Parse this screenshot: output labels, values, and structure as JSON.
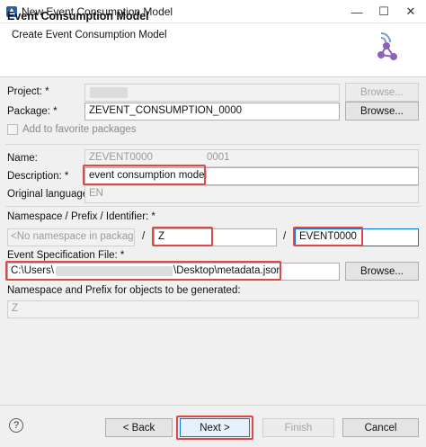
{
  "window": {
    "title": "New Event Consumption Model",
    "minimize_glyph": "—",
    "maximize_glyph": "☐",
    "close_glyph": "✕"
  },
  "banner": {
    "title": "Event Consumption Model",
    "subtitle": "Create Event Consumption Model"
  },
  "form": {
    "project_label": "Project: *",
    "project_value": "",
    "project_browse": "Browse...",
    "package_label": "Package: *",
    "package_value": "ZEVENT_CONSUMPTION_0000",
    "package_browse": "Browse...",
    "favorite_label": "Add to favorite packages",
    "name_label": "Name:",
    "name_value_left": "ZEVENT0000",
    "name_value_right": "0001",
    "description_label": "Description: *",
    "description_value": "event consumption model",
    "language_label": "Original language:",
    "language_value": "EN",
    "ns_label": "Namespace / Prefix / Identifier: *",
    "ns_select": "<No namespace in package>",
    "ns_sep1": "/",
    "prefix_value": "Z",
    "ns_sep2": "/",
    "identifier_value": "EVENT0000",
    "spec_label": "Event Specification File: *",
    "spec_value_start": "C:\\Users\\",
    "spec_value_end": "\\Desktop\\metadata.json",
    "spec_browse": "Browse...",
    "gen_label": "Namespace and Prefix for objects to be generated:",
    "gen_value": "Z"
  },
  "footer": {
    "help_glyph": "?",
    "back_label": "< Back",
    "next_label": "Next >",
    "finish_label": "Finish",
    "cancel_label": "Cancel"
  },
  "colors": {
    "highlight": "#d94b4b",
    "accent": "#0078d7",
    "banner_icon": "#8c63b8"
  }
}
